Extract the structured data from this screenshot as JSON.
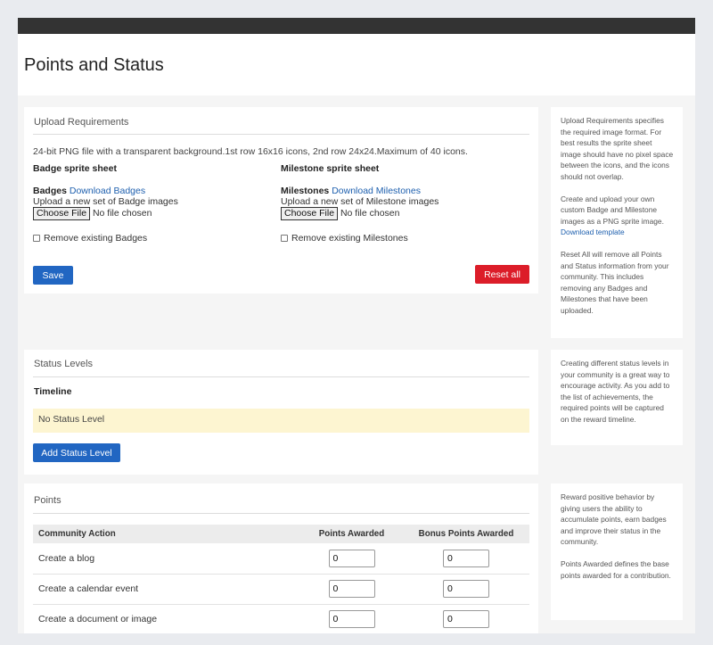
{
  "page_title": "Points and Status",
  "upload": {
    "heading": "Upload Requirements",
    "requirements_text": "24-bit PNG file with a transparent background.1st row 16x16 icons, 2nd row 24x24.Maximum of 40 icons.",
    "badge": {
      "title": "Badge sprite sheet",
      "label": "Badges",
      "download_link": "Download Badges",
      "upload_hint": "Upload a new set of Badge images",
      "choose_file": "Choose File",
      "no_file": "No file chosen",
      "remove_label": "Remove existing Badges"
    },
    "milestone": {
      "title": "Milestone sprite sheet",
      "label": "Milestones",
      "download_link": "Download Milestones",
      "upload_hint": "Upload a new set of Milestone images",
      "choose_file": "Choose File",
      "no_file": "No file chosen",
      "remove_label": "Remove existing Milestones"
    },
    "save_label": "Save",
    "reset_label": "Reset all"
  },
  "upload_help": {
    "p1": "Upload Requirements specifies the required image format. For best results the sprite sheet image should have no pixel space between the icons, and the icons should not overlap.",
    "p2": "Create and upload your own custom Badge and Milestone images as a PNG sprite image.",
    "p2_link": "Download template",
    "p3": "Reset All will remove all Points and Status information from your community. This includes removing any Badges and Milestones that have been uploaded."
  },
  "status": {
    "heading": "Status Levels",
    "timeline_label": "Timeline",
    "empty_notice": "No Status Level",
    "add_button": "Add Status Level"
  },
  "status_help": {
    "p1": "Creating different status levels in your community is a great way to encourage activity. As you add to the list of achievements, the required points will be captured on the reward timeline."
  },
  "points": {
    "heading": "Points",
    "columns": [
      "Community Action",
      "Points Awarded",
      "Bonus Points Awarded"
    ],
    "rows": [
      {
        "action": "Create a blog",
        "points": "0",
        "bonus": "0"
      },
      {
        "action": "Create a calendar event",
        "points": "0",
        "bonus": "0"
      },
      {
        "action": "Create a document or image",
        "points": "0",
        "bonus": "0"
      }
    ]
  },
  "points_help": {
    "p1": "Reward positive behavior by giving users the ability to accumulate points, earn badges and improve their status in the community.",
    "p2": "Points Awarded defines the base points awarded for a contribution."
  },
  "colors": {
    "topbar": "#333333",
    "primary_button": "#2166c2",
    "danger_button": "#dc1d29",
    "notice_bg": "#fdf5d1",
    "link": "#1d5fae"
  }
}
